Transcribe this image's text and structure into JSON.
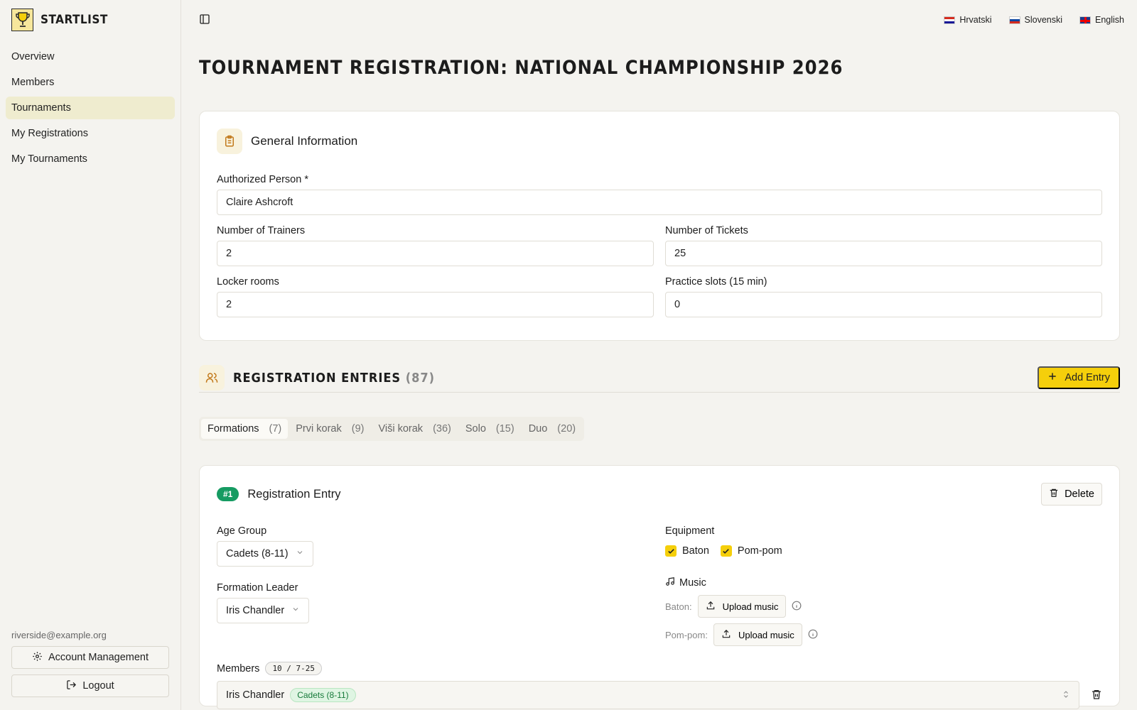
{
  "brand": {
    "name": "STARTLIST"
  },
  "nav": [
    {
      "label": "Overview",
      "active": false
    },
    {
      "label": "Members",
      "active": false
    },
    {
      "label": "Tournaments",
      "active": true
    },
    {
      "label": "My Registrations",
      "active": false
    },
    {
      "label": "My Tournaments",
      "active": false
    }
  ],
  "user": {
    "email": "riverside@example.org",
    "account_label": "Account Management",
    "logout_label": "Logout"
  },
  "languages": [
    {
      "label": "Hrvatski",
      "flag": "flag-hr"
    },
    {
      "label": "Slovenski",
      "flag": "flag-si"
    },
    {
      "label": "English",
      "flag": "flag-en"
    }
  ],
  "page": {
    "title": "TOURNAMENT REGISTRATION: NATIONAL CHAMPIONSHIP 2026"
  },
  "general": {
    "title": "General Information",
    "authorized_label": "Authorized Person *",
    "authorized_value": "Claire Ashcroft",
    "trainers_label": "Number of Trainers",
    "trainers_value": "2",
    "tickets_label": "Number of Tickets",
    "tickets_value": "25",
    "lockers_label": "Locker rooms",
    "lockers_value": "2",
    "practice_label": "Practice slots (15 min)",
    "practice_value": "0"
  },
  "entries": {
    "title": "REGISTRATION ENTRIES",
    "count": "(87)",
    "add_label": "Add Entry",
    "tabs": [
      {
        "label": "Formations",
        "count": "(7)",
        "active": true
      },
      {
        "label": "Prvi korak",
        "count": "(9)",
        "active": false
      },
      {
        "label": "Viši korak",
        "count": "(36)",
        "active": false
      },
      {
        "label": "Solo",
        "count": "(15)",
        "active": false
      },
      {
        "label": "Duo",
        "count": "(20)",
        "active": false
      }
    ]
  },
  "entry": {
    "number": "#1",
    "title": "Registration Entry",
    "delete_label": "Delete",
    "age_group_label": "Age Group",
    "age_group_value": "Cadets (8-11)",
    "leader_label": "Formation Leader",
    "leader_value": "Iris Chandler",
    "equipment_label": "Equipment",
    "equipment": [
      "Baton",
      "Pom-pom"
    ],
    "music_label": "Music",
    "music_rows": [
      {
        "label": "Baton:",
        "button": "Upload music"
      },
      {
        "label": "Pom-pom:",
        "button": "Upload music"
      }
    ],
    "members_label": "Members",
    "members_badge": "10 / 7-25",
    "member_name": "Iris Chandler",
    "member_badge": "Cadets (8-11)"
  },
  "colors": {
    "accent": "#f5cf0b",
    "green": "#169b62",
    "background": "#f4f3ef"
  }
}
